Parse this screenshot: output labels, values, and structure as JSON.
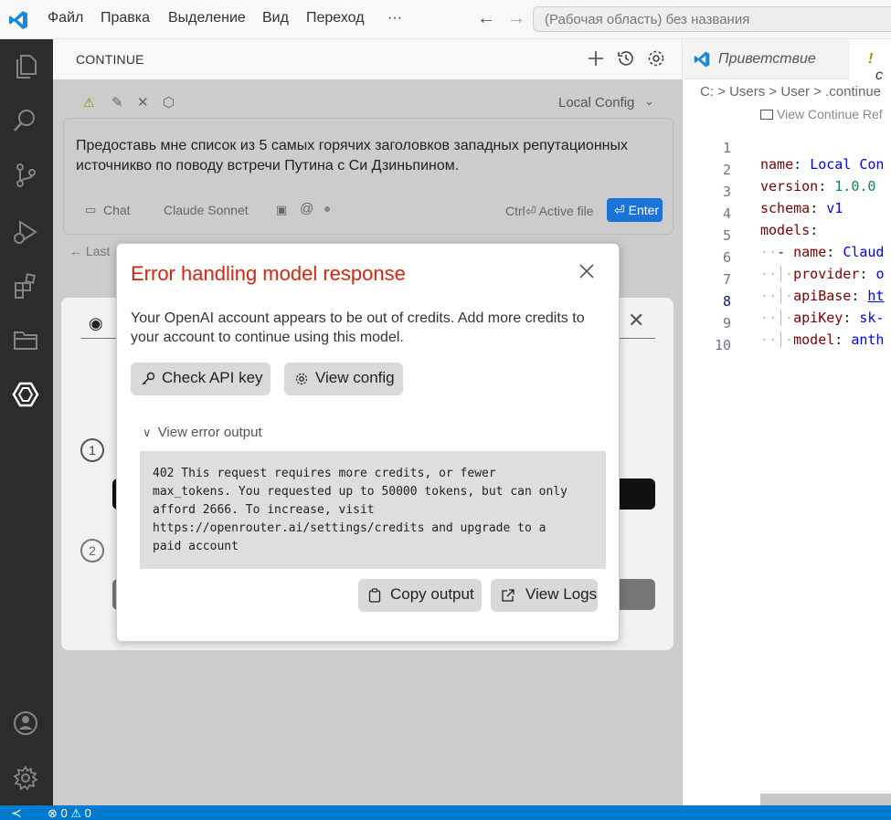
{
  "titlebar": {
    "menus": [
      "Файл",
      "Правка",
      "Выделение",
      "Вид",
      "Переход",
      "···"
    ],
    "search_placeholder": "(Рабочая область) без названия"
  },
  "activity_bar": {
    "icons": [
      "files-icon",
      "search-icon",
      "source-control-icon",
      "run-debug-icon",
      "extensions-icon",
      "folder-icon",
      "continue-icon",
      "account-icon",
      "settings-gear-icon"
    ],
    "active": "continue-icon"
  },
  "panel": {
    "title": "CONTINUE",
    "config_label": "Local Config",
    "prompt": "Предоставь мне список из 5 самых горячих заголовков западных репутационных источникво по поводу встречи Путина с Си Дзиньпином.",
    "mode_label": "Chat",
    "model_label": "Claude Sonnet",
    "active_file_hint": "Ctrl⏎ Active file",
    "enter_label": "⏎ Enter",
    "last_link": "Last",
    "steps": [
      "1",
      "2"
    ]
  },
  "modal": {
    "title": "Error handling model response",
    "message": "Your OpenAI account appears to be out of credits. Add more credits to your account to continue using this model.",
    "check_api_key": "Check API key",
    "view_config": "View config",
    "error_toggle": "View error output",
    "error_output": "402 This request requires more credits, or fewer\nmax_tokens. You requested up to 50000 tokens, but can only\nafford 2666. To increase, visit\nhttps://openrouter.ai/settings/credits and upgrade to a\npaid account",
    "copy_output": "Copy output",
    "view_logs": "View Logs"
  },
  "editor": {
    "tab_welcome": "Приветствие",
    "tab_second_prefix": "!",
    "tab_second_label": "c",
    "breadcrumb": "C: > Users > User > .continue",
    "codelens": "View Continue Ref",
    "lines": [
      {
        "n": "1",
        "key": "name",
        "val": "Local Con"
      },
      {
        "n": "2",
        "key": "version",
        "val": "1.0.0"
      },
      {
        "n": "3",
        "key": "schema",
        "val": "v1"
      },
      {
        "n": "4",
        "key": "models",
        "val": ""
      },
      {
        "n": "5",
        "key": "name",
        "val": "Claud"
      },
      {
        "n": "6",
        "key": "provider",
        "val": "o"
      },
      {
        "n": "7",
        "key": "apiBase",
        "val": "ht"
      },
      {
        "n": "8",
        "key": "apiKey",
        "val": "sk-"
      },
      {
        "n": "9",
        "key": "model",
        "val": "anth"
      },
      {
        "n": "10",
        "key": "",
        "val": ""
      }
    ]
  },
  "statusbar": {
    "errors": "0",
    "warnings": "0"
  },
  "colors": {
    "accent": "#007acc",
    "error_title": "#d7260f",
    "enter_button": "#1a73d9"
  }
}
